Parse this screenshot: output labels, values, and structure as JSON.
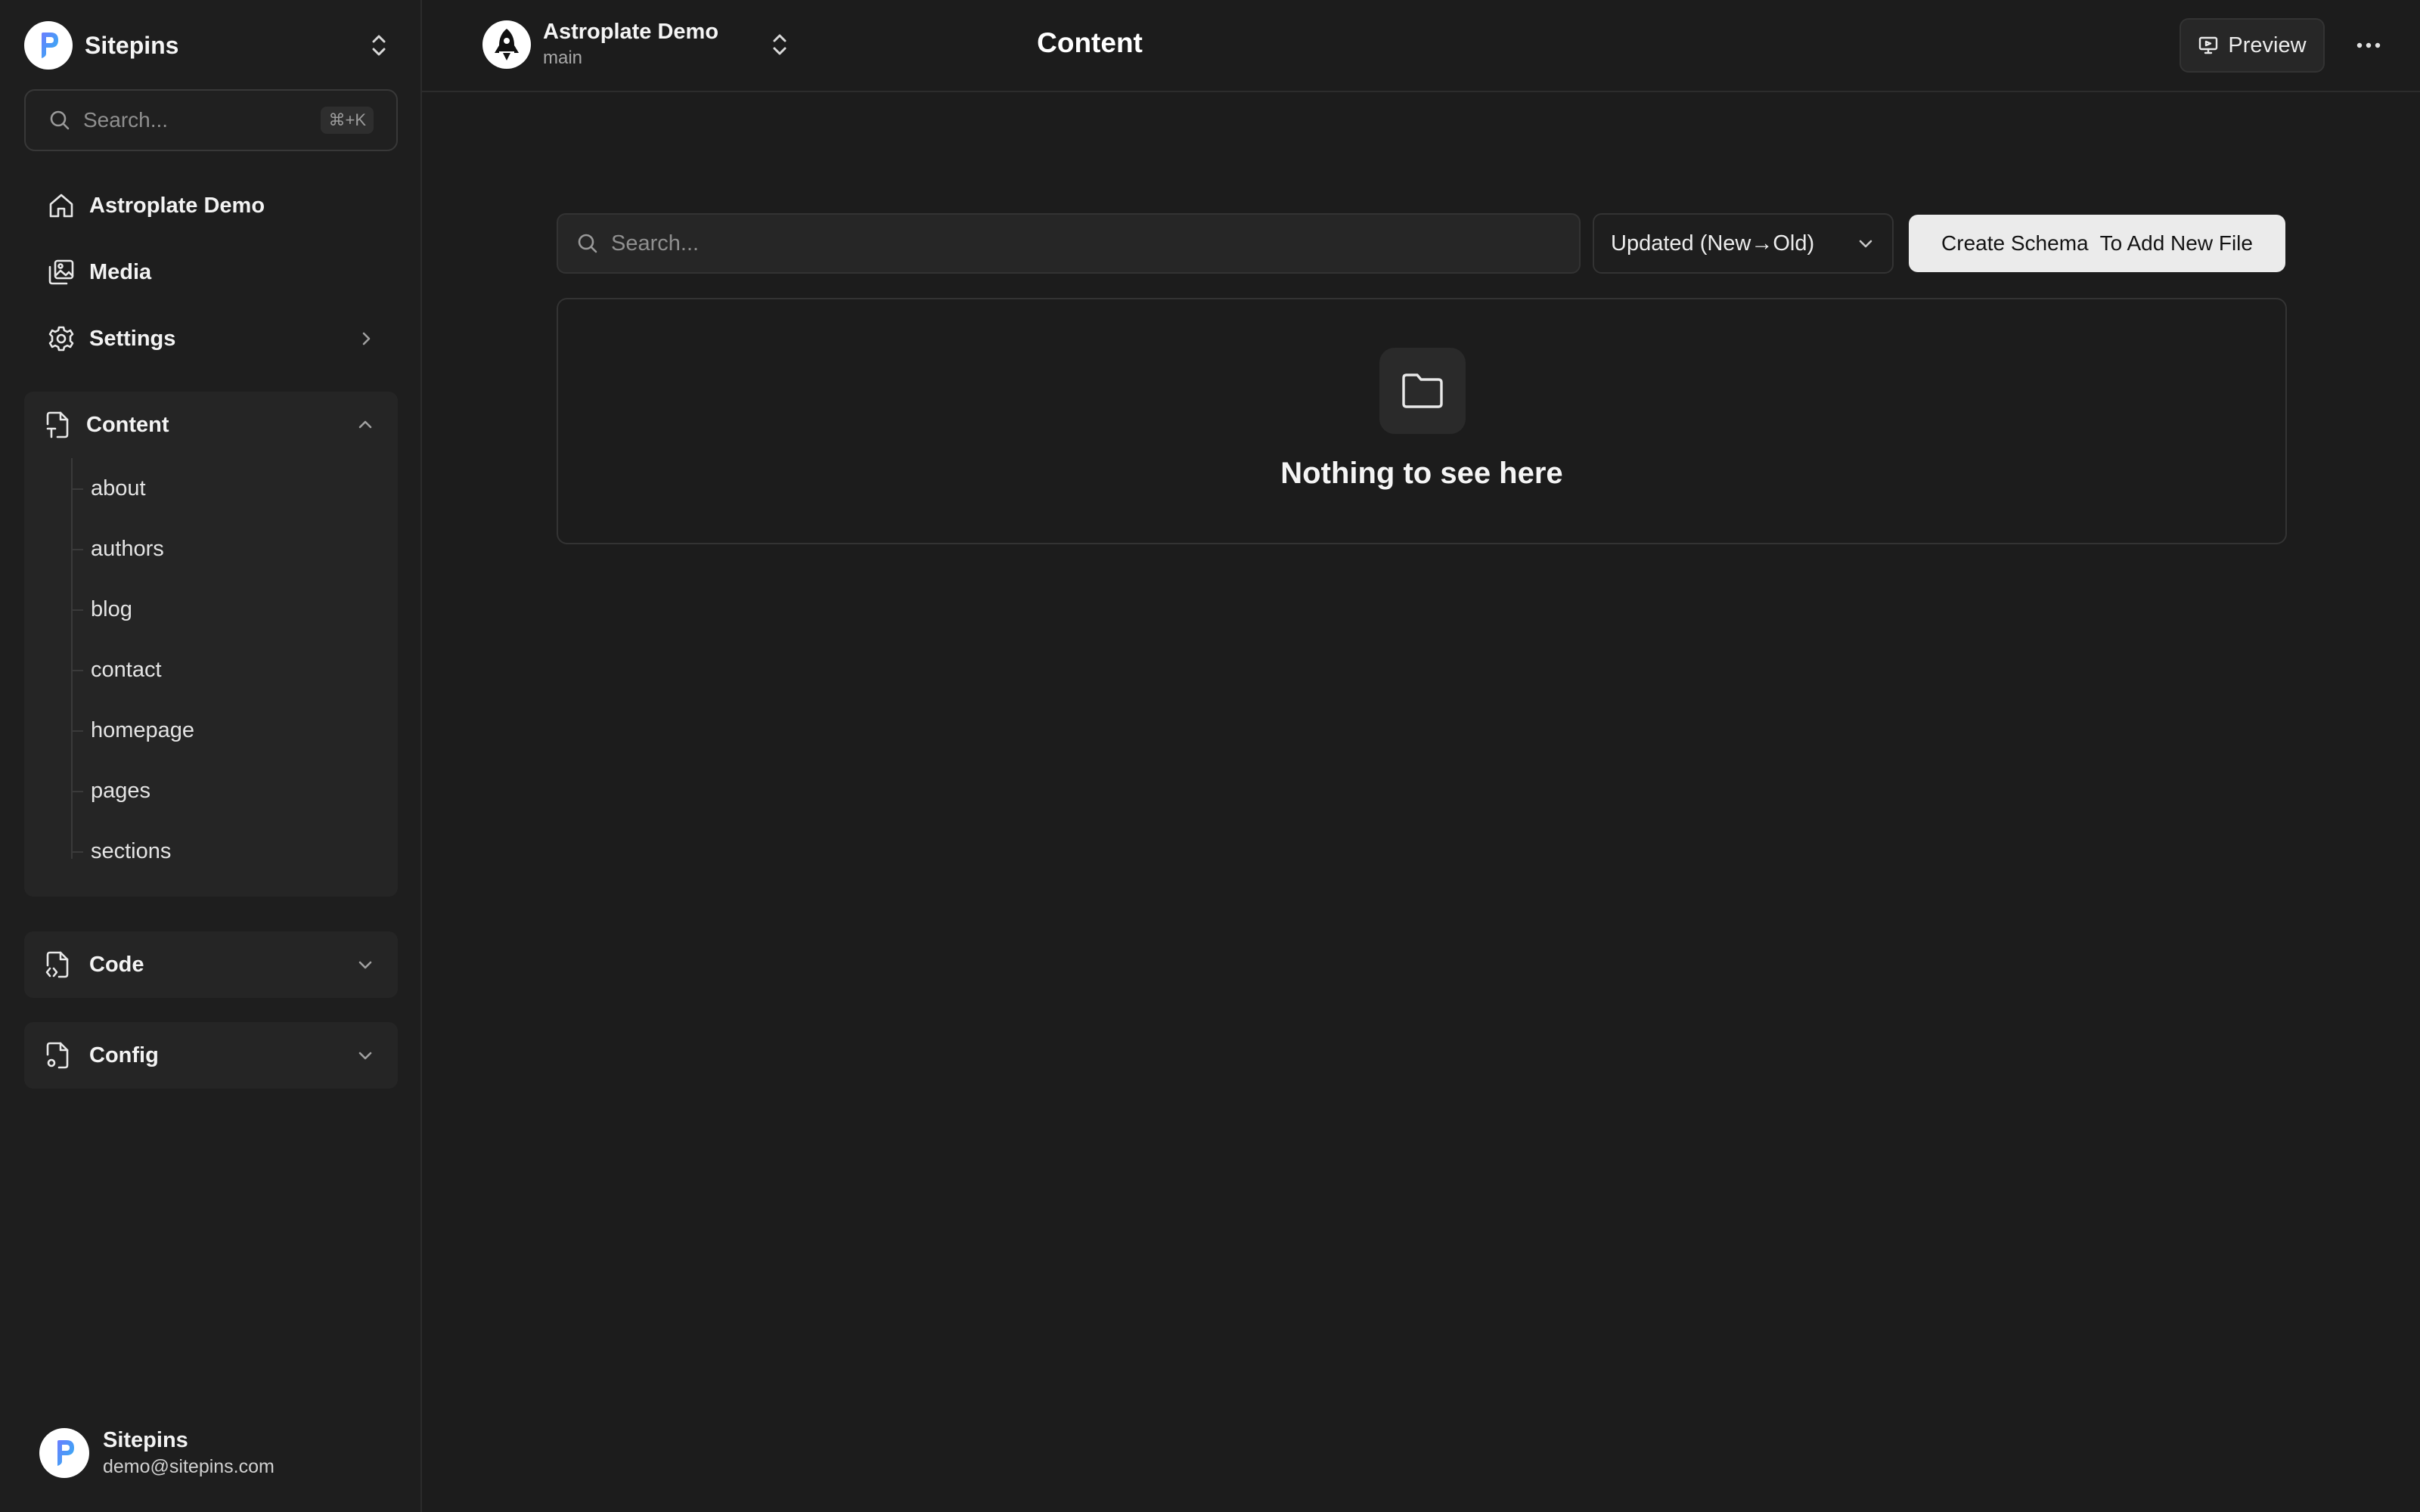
{
  "sidebar": {
    "brand": {
      "name": "Sitepins"
    },
    "search": {
      "placeholder": "Search...",
      "shortcut": "⌘+K"
    },
    "nav": [
      {
        "label": "Astroplate Demo",
        "icon": "home-icon"
      },
      {
        "label": "Media",
        "icon": "media-icon"
      },
      {
        "label": "Settings",
        "icon": "gear-icon"
      }
    ],
    "content_section": {
      "label": "Content",
      "items": [
        "about",
        "authors",
        "blog",
        "contact",
        "homepage",
        "pages",
        "sections"
      ]
    },
    "code_section": {
      "label": "Code"
    },
    "config_section": {
      "label": "Config"
    },
    "user": {
      "name": "Sitepins",
      "email": "demo@sitepins.com"
    }
  },
  "topbar": {
    "project": {
      "name": "Astroplate Demo",
      "branch": "main"
    },
    "title": "Content",
    "preview_label": "Preview"
  },
  "main": {
    "search_placeholder": "Search...",
    "sort_value": "Updated (New→Old)",
    "create_label": "Create Schema  To Add New File",
    "empty_text": "Nothing to see here"
  },
  "colors": {
    "background": "#1c1c1c",
    "sidebar": "#1e1e1e",
    "section": "#252525",
    "primary_button": "#ebebeb"
  }
}
